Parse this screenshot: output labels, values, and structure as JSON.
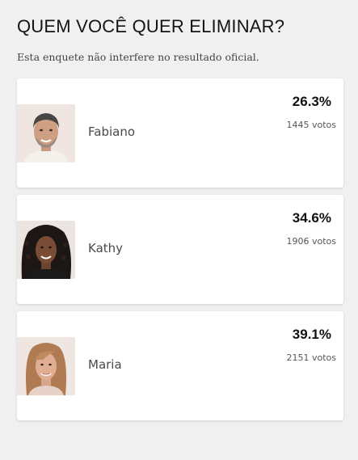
{
  "poll": {
    "title": "QUEM VOCÊ QUER ELIMINAR?",
    "disclaimer": "Esta enquete não interfere no resultado oficial."
  },
  "options": [
    {
      "name": "Fabiano",
      "percent_label": "26.3%",
      "votes_label": "1445 votos",
      "percent": 26.3,
      "votes": 1445
    },
    {
      "name": "Kathy",
      "percent_label": "34.6%",
      "votes_label": "1906 votos",
      "percent": 34.6,
      "votes": 1906
    },
    {
      "name": "Maria",
      "percent_label": "39.1%",
      "votes_label": "2151 votos",
      "percent": 39.1,
      "votes": 2151
    }
  ],
  "colors": {
    "page_background": "#f0f0f1",
    "card_background": "#ffffff",
    "title_text": "#141414",
    "name_text": "#4a4a4a"
  }
}
